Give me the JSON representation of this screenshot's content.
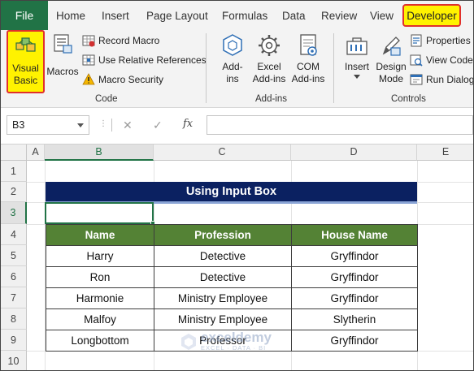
{
  "tabs": {
    "file": "File",
    "home": "Home",
    "insert": "Insert",
    "page_layout": "Page Layout",
    "formulas": "Formulas",
    "data": "Data",
    "review": "Review",
    "view": "View",
    "developer": "Developer"
  },
  "ribbon": {
    "code": {
      "visual_basic": [
        "Visual",
        "Basic"
      ],
      "macros": "Macros",
      "record_macro": "Record Macro",
      "use_relative_references": "Use Relative References",
      "macro_security": "Macro Security",
      "group_label": "Code"
    },
    "addins": {
      "addins": [
        "Add-",
        "ins"
      ],
      "excel_addins": [
        "Excel",
        "Add-ins"
      ],
      "com_addins": [
        "COM",
        "Add-ins"
      ],
      "group_label": "Add-ins"
    },
    "controls": {
      "insert": "Insert",
      "design_mode": [
        "Design",
        "Mode"
      ],
      "properties": "Properties",
      "view_code": "View Code",
      "run_dialog": "Run Dialog",
      "group_label": "Controls"
    }
  },
  "formula_bar": {
    "name_box": "B3",
    "cancel_glyph": "✕",
    "enter_glyph": "✓",
    "fx_label": "fx",
    "formula": ""
  },
  "sheet": {
    "columns": [
      "A",
      "B",
      "C",
      "D",
      "E"
    ],
    "rows": [
      "1",
      "2",
      "3",
      "4",
      "5",
      "6",
      "7",
      "8",
      "9",
      "10"
    ],
    "selected_cell": "B3",
    "title": "Using Input Box",
    "headers": [
      "Name",
      "Profession",
      "House Name"
    ],
    "records": [
      [
        "Harry",
        "Detective",
        "Gryffindor"
      ],
      [
        "Ron",
        "Detective",
        "Gryffindor"
      ],
      [
        "Harmonie",
        "Ministry Employee",
        "Gryffindor"
      ],
      [
        "Malfoy",
        "Ministry Employee",
        "Slytherin"
      ],
      [
        "Longbottom",
        "Professor",
        "Gryffindor"
      ]
    ]
  },
  "watermark": {
    "name": "exceldemy",
    "tagline": "EXCEL · DATA · BI"
  },
  "colors": {
    "file_tab": "#217346",
    "highlight_fill": "#fff200",
    "highlight_border": "#e0302c",
    "title_fill": "#0b2161",
    "header_fill": "#548235",
    "selection": "#217346"
  }
}
